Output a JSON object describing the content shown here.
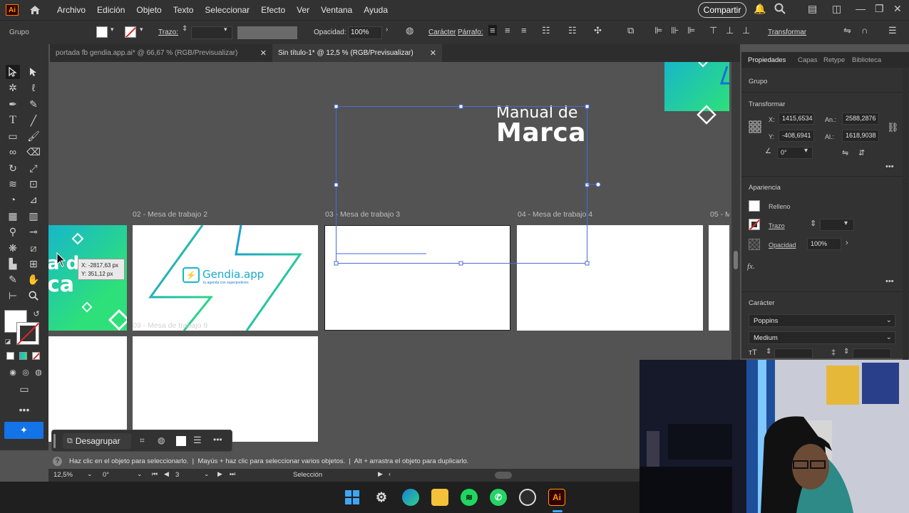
{
  "app": {
    "logo": "Ai",
    "menu": [
      "Archivo",
      "Edición",
      "Objeto",
      "Texto",
      "Seleccionar",
      "Efecto",
      "Ver",
      "Ventana",
      "Ayuda"
    ],
    "share_label": "Compartir"
  },
  "control_bar": {
    "selection_type": "Grupo",
    "stroke_label": "Trazo:",
    "opacity_label": "Opacidad:",
    "opacity_value": "100%",
    "character_label": "Carácter",
    "paragraph_label": "Párrafo:",
    "transform_label": "Transformar"
  },
  "tabs": [
    {
      "label": "portada fb gendia.app.ai* @ 66,67 % (RGB/Previsualizar)",
      "active": false
    },
    {
      "label": "Sin título-1* @ 12,5 % (RGB/Previsualizar)",
      "active": true
    }
  ],
  "canvas": {
    "title_line1": "Manual de",
    "title_line2": "Marca",
    "artboards": [
      {
        "label": "02 - Mesa de trabajo 2"
      },
      {
        "label": "03 - Mesa de trabajo 3"
      },
      {
        "label": "04 - Mesa de trabajo 4"
      },
      {
        "label": "05 - M"
      },
      {
        "label": "09 - Mesa de trabajo 9"
      }
    ],
    "cover_text_a": "a de",
    "cover_text_b": "ca",
    "logo_name": "Gendia.app",
    "logo_tagline": "tu agenda con superpoderes",
    "tooltip_x": "X: -2817,63 px",
    "tooltip_y": "Y: 351,12 px"
  },
  "properties": {
    "tabs": [
      "Propiedades",
      "Capas",
      "Retype",
      "Biblioteca"
    ],
    "selection_type": "Grupo",
    "transform_header": "Transformar",
    "x_label": "X:",
    "x_value": "1415,6534",
    "y_label": "Y:",
    "y_value": "-408,6941",
    "w_label": "An.:",
    "w_value": "2588,2876",
    "h_label": "Al.:",
    "h_value": "1618,9038",
    "angle_value": "0°",
    "appearance_header": "Apariencia",
    "fill_label": "Relleno",
    "stroke_label": "Trazo",
    "opacity_label": "Opacidad",
    "opacity_value": "100%",
    "fx_label": "fx.",
    "character_header": "Carácter",
    "font_family": "Poppins",
    "font_style": "Medium"
  },
  "context_bar": {
    "ungroup_label": "Desagrupar"
  },
  "status": {
    "hint": "Haz clic en el objeto para seleccionarlo.  |  Mayús + haz clic para seleccionar varios objetos.  |  Alt + arrastra el objeto para duplicarlo.",
    "zoom": "12,5%",
    "rotation": "0°",
    "artboard_number": "3",
    "tool_name": "Selección"
  },
  "colors": {
    "accent": "#1473e6",
    "green": "#2ee07a",
    "teal": "#17b7c9",
    "ai_orange": "#ff9a00"
  },
  "taskbar_icons": [
    "windows-icon",
    "settings-icon",
    "edge-icon",
    "folder-icon",
    "spotify-icon",
    "whatsapp-icon",
    "obs-icon",
    "illustrator-icon"
  ]
}
